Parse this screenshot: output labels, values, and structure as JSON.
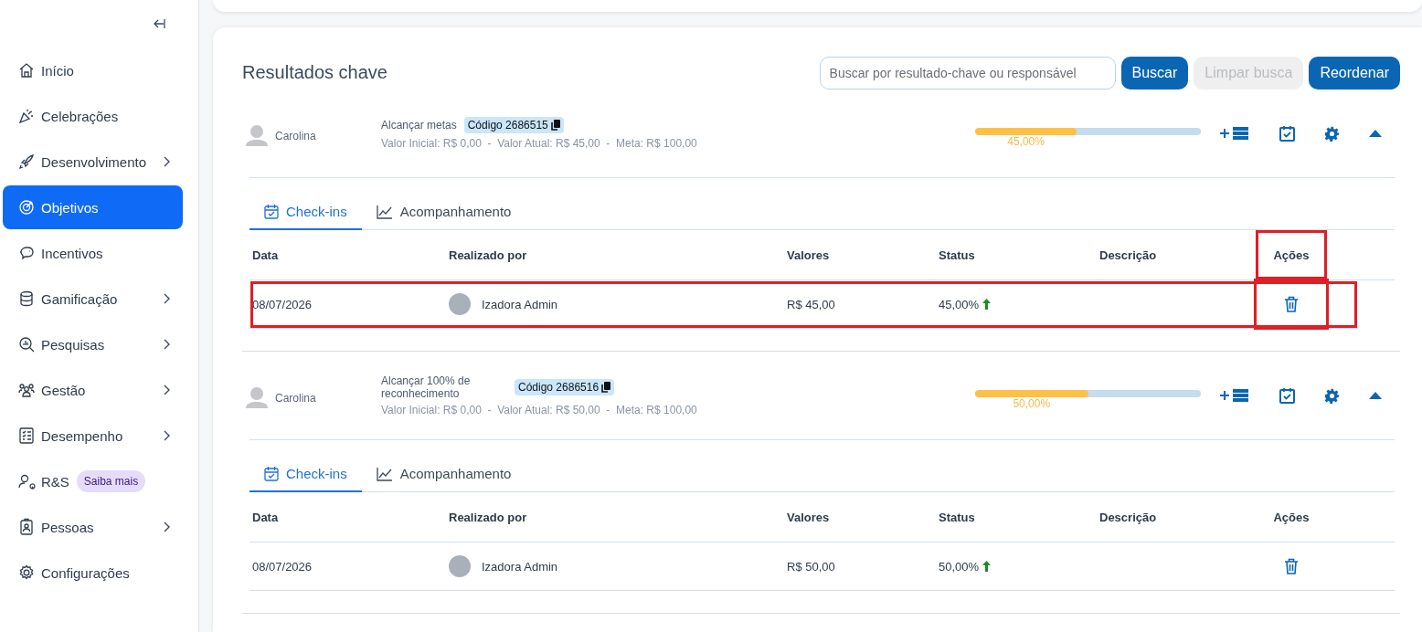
{
  "sidebar": {
    "items": [
      {
        "label": "Início",
        "selected": false,
        "submenu": false
      },
      {
        "label": "Celebrações",
        "selected": false,
        "submenu": false
      },
      {
        "label": "Desenvolvimento",
        "selected": false,
        "submenu": true
      },
      {
        "label": "Objetivos",
        "selected": true,
        "submenu": false
      },
      {
        "label": "Incentivos",
        "selected": false,
        "submenu": false
      },
      {
        "label": "Gamificação",
        "selected": false,
        "submenu": true
      },
      {
        "label": "Pesquisas",
        "selected": false,
        "submenu": true
      },
      {
        "label": "Gestão",
        "selected": false,
        "submenu": true
      },
      {
        "label": "Desempenho",
        "selected": false,
        "submenu": true
      },
      {
        "label": "R&S",
        "selected": false,
        "submenu": false,
        "badge": "Saiba mais"
      },
      {
        "label": "Pessoas",
        "selected": false,
        "submenu": true
      },
      {
        "label": "Configurações",
        "selected": false,
        "submenu": false
      }
    ]
  },
  "section": {
    "title": "Resultados chave",
    "search": {
      "placeholder": "Buscar por resultado-chave ou responsável"
    },
    "buttons": [
      {
        "label": "Buscar",
        "disabled": false
      },
      {
        "label": "Limpar busca",
        "disabled": true
      },
      {
        "label": "Reordenar",
        "disabled": false
      }
    ]
  },
  "key_results": [
    {
      "owner": "Carolina",
      "title": "Alcançar metas",
      "code": "Código 2686515",
      "values_line": "Valor Inicial: R$ 0,00  -  Valor Atual: R$ 45,00  -  Meta: R$ 100,00",
      "progress": {
        "level": 0.45,
        "reading": "45,00%"
      },
      "expanded": true,
      "tabs": [
        {
          "label": "Check-ins",
          "selected": true
        },
        {
          "label": "Acompanhamento",
          "selected": false
        }
      ],
      "columns": [
        {
          "label": "Data",
          "highlighted": false
        },
        {
          "label": "Realizado por",
          "highlighted": false
        },
        {
          "label": "Valores",
          "highlighted": false
        },
        {
          "label": "Status",
          "highlighted": false
        },
        {
          "label": "Descrição",
          "highlighted": false
        },
        {
          "label": "Ações",
          "highlighted": true
        }
      ],
      "rows": [
        {
          "date": "08/07/2026",
          "user": "Izadora Admin",
          "value": "R$ 45,00",
          "status": "45,00%",
          "trend_up": true,
          "highlighted": true
        }
      ]
    },
    {
      "owner": "Carolina",
      "title": "Alcançar 100% de reconhecimento",
      "code": "Código 2686516",
      "values_line": "Valor Inicial: R$ 0,00  -  Valor Atual: R$ 50,00  -  Meta: R$ 100,00",
      "progress": {
        "level": 0.5,
        "reading": "50,00%"
      },
      "expanded": true,
      "tabs": [
        {
          "label": "Check-ins",
          "selected": true
        },
        {
          "label": "Acompanhamento",
          "selected": false
        }
      ],
      "columns": [
        {
          "label": "Data",
          "highlighted": false
        },
        {
          "label": "Realizado por",
          "highlighted": false
        },
        {
          "label": "Valores",
          "highlighted": false
        },
        {
          "label": "Status",
          "highlighted": false
        },
        {
          "label": "Descrição",
          "highlighted": false
        },
        {
          "label": "Ações",
          "highlighted": false
        }
      ],
      "rows": [
        {
          "date": "08/07/2026",
          "user": "Izadora Admin",
          "value": "R$ 50,00",
          "status": "50,00%",
          "trend_up": true,
          "highlighted": false
        }
      ]
    }
  ]
}
